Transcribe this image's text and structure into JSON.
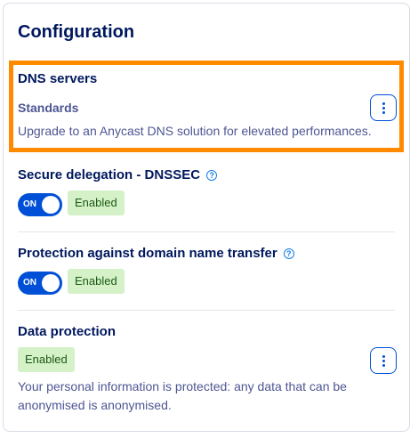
{
  "card": {
    "title": "Configuration"
  },
  "dns": {
    "title": "DNS servers",
    "offer": "Standards",
    "description": "Upgrade to an Anycast DNS solution for elevated performances."
  },
  "dnssec": {
    "title": "Secure delegation - DNSSEC",
    "help_icon": "?",
    "toggle_label": "ON",
    "status": "Enabled"
  },
  "transfer_protection": {
    "title": "Protection against domain name transfer",
    "help_icon": "?",
    "toggle_label": "ON",
    "status": "Enabled"
  },
  "data_protection": {
    "title": "Data protection",
    "status": "Enabled",
    "description": "Your personal information is protected: any data that can be anonymised is anonymised."
  },
  "colors": {
    "highlight": "#ff8a00",
    "primary": "#0050d7",
    "badge_bg": "#d4f1c8"
  },
  "icons": {
    "menu": "more-vertical-icon",
    "help": "question-circle-icon"
  }
}
